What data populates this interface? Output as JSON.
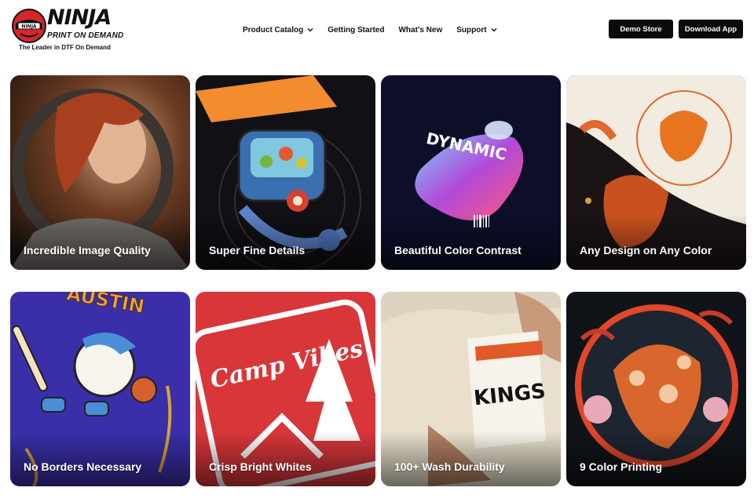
{
  "brand": {
    "name": "NINJA",
    "subtitle": "PRINT ON DEMAND",
    "tagline": "The Leader in DTF On Demand",
    "mark_text": "NINJA"
  },
  "nav": {
    "items": [
      {
        "label": "Product Catalog",
        "has_dropdown": true
      },
      {
        "label": "Getting Started",
        "has_dropdown": false
      },
      {
        "label": "What’s New",
        "has_dropdown": false
      },
      {
        "label": "Support",
        "has_dropdown": true
      }
    ]
  },
  "actions": {
    "demo_store": "Demo Store",
    "download_app": "Download App"
  },
  "cards": [
    {
      "label": "Incredible Image Quality",
      "art_text": ""
    },
    {
      "label": "Super Fine Details",
      "art_text": ""
    },
    {
      "label": "Beautiful Color Contrast",
      "art_text": "DYNAMIC"
    },
    {
      "label": "Any Design on Any Color",
      "art_text": ""
    },
    {
      "label": "No Borders Necessary",
      "art_text": "AUSTIN"
    },
    {
      "label": "Crisp Bright Whites",
      "art_text": "Camp Vibes"
    },
    {
      "label": "100+ Wash Durability",
      "art_text": "KINGS"
    },
    {
      "label": "9 Color Printing",
      "art_text": ""
    }
  ],
  "colors": {
    "button_bg": "#0b0b0b",
    "button_text": "#ffffff",
    "logo_red": "#d7262b"
  }
}
